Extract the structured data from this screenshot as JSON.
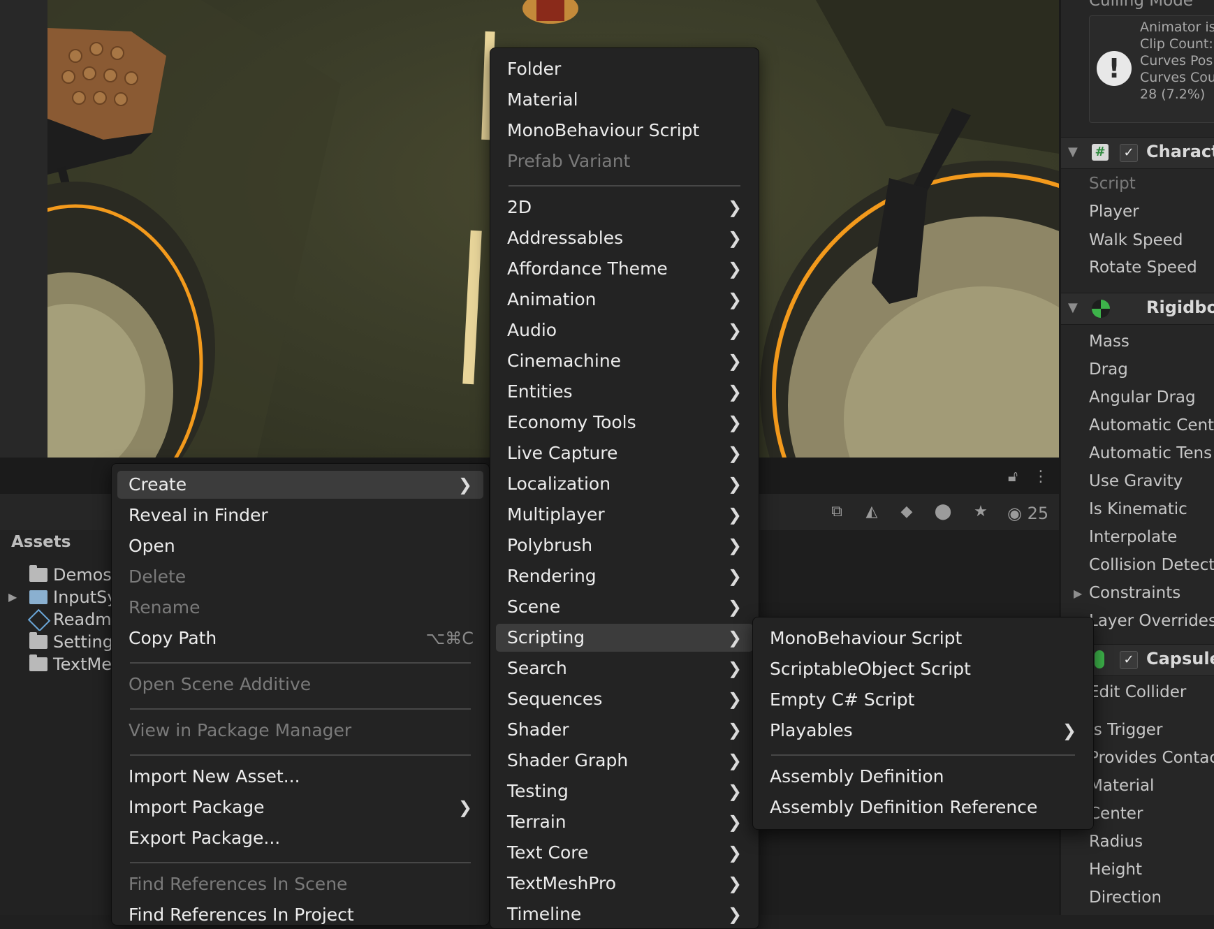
{
  "colors": {
    "menu_bg": "#232323",
    "menu_highlight": "#3c3c3c",
    "accent_orange": "#f39a1c",
    "scene_bg": "#3d3f2a"
  },
  "project": {
    "tree_title": "Assets",
    "tree_items": [
      {
        "label": "Demos",
        "icon": "folder-icon"
      },
      {
        "label": "InputSy",
        "icon": "input-system-icon"
      },
      {
        "label": "Readm",
        "icon": "readme-icon"
      },
      {
        "label": "Setting",
        "icon": "folder-icon"
      },
      {
        "label": "TextMe",
        "icon": "folder-icon"
      }
    ],
    "visible_count": "25"
  },
  "context_menu": {
    "items": [
      {
        "label": "Create",
        "submenu": true,
        "highlight": true
      },
      {
        "label": "Reveal in Finder"
      },
      {
        "label": "Open"
      },
      {
        "label": "Delete",
        "disabled": true
      },
      {
        "label": "Rename",
        "disabled": true
      },
      {
        "label": "Copy Path",
        "shortcut": "⌥⌘C"
      },
      {
        "separator": true
      },
      {
        "label": "Open Scene Additive",
        "disabled": true
      },
      {
        "separator": true
      },
      {
        "label": "View in Package Manager",
        "disabled": true
      },
      {
        "separator": true
      },
      {
        "label": "Import New Asset..."
      },
      {
        "label": "Import Package",
        "submenu": true
      },
      {
        "label": "Export Package..."
      },
      {
        "separator": true
      },
      {
        "label": "Find References In Scene",
        "disabled": true
      },
      {
        "label": "Find References In Project"
      }
    ]
  },
  "create_menu": {
    "items": [
      {
        "label": "Folder"
      },
      {
        "label": "Material"
      },
      {
        "label": "MonoBehaviour Script"
      },
      {
        "label": "Prefab Variant",
        "disabled": true
      },
      {
        "separator": true
      },
      {
        "label": "2D",
        "submenu": true
      },
      {
        "label": "Addressables",
        "submenu": true
      },
      {
        "label": "Affordance Theme",
        "submenu": true
      },
      {
        "label": "Animation",
        "submenu": true
      },
      {
        "label": "Audio",
        "submenu": true
      },
      {
        "label": "Cinemachine",
        "submenu": true
      },
      {
        "label": "Entities",
        "submenu": true
      },
      {
        "label": "Economy Tools",
        "submenu": true
      },
      {
        "label": "Live Capture",
        "submenu": true
      },
      {
        "label": "Localization",
        "submenu": true
      },
      {
        "label": "Multiplayer",
        "submenu": true
      },
      {
        "label": "Polybrush",
        "submenu": true
      },
      {
        "label": "Rendering",
        "submenu": true
      },
      {
        "label": "Scene",
        "submenu": true
      },
      {
        "label": "Scripting",
        "submenu": true,
        "highlight": true
      },
      {
        "label": "Search",
        "submenu": true
      },
      {
        "label": "Sequences",
        "submenu": true
      },
      {
        "label": "Shader",
        "submenu": true
      },
      {
        "label": "Shader Graph",
        "submenu": true
      },
      {
        "label": "Testing",
        "submenu": true
      },
      {
        "label": "Terrain",
        "submenu": true
      },
      {
        "label": "Text Core",
        "submenu": true
      },
      {
        "label": "TextMeshPro",
        "submenu": true
      },
      {
        "label": "Timeline",
        "submenu": true
      }
    ]
  },
  "scripting_menu": {
    "items": [
      {
        "label": "MonoBehaviour Script"
      },
      {
        "label": "ScriptableObject Script"
      },
      {
        "label": "Empty C# Script"
      },
      {
        "label": "Playables",
        "submenu": true
      },
      {
        "separator": true
      },
      {
        "label": "Assembly Definition"
      },
      {
        "label": "Assembly Definition Reference"
      }
    ]
  },
  "inspector": {
    "culling_mode": "Culling Mode",
    "animator_info": "Animator is\nClip Count:\nCurves Pos\nCurves Cou\n28 (7.2%)",
    "character_component": {
      "title": "Characte",
      "script_label": "Script",
      "fields": [
        "Player",
        "Walk Speed",
        "Rotate Speed"
      ]
    },
    "rigidbody_component": {
      "title": "Rigidboc",
      "fields": [
        "Mass",
        "Drag",
        "Angular Drag",
        "Automatic Cente",
        "Automatic Tens",
        "Use Gravity",
        "Is Kinematic",
        "Interpolate",
        "Collision Detecti",
        "Constraints",
        "Layer Overrides"
      ]
    },
    "capsule_component": {
      "title": "Capsule",
      "fields": [
        "Edit Collider",
        "Is Trigger",
        "Provides Contac",
        "Material",
        "Center",
        "Radius",
        "Height",
        "Direction"
      ]
    }
  }
}
